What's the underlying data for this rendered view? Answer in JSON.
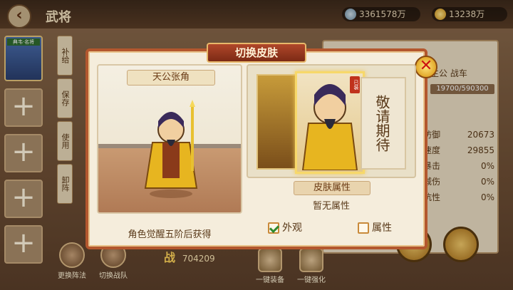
{
  "header": {
    "back_icon": "back-arrow-icon",
    "title": "武将",
    "silver": "3361578万",
    "gold": "13238万"
  },
  "left": {
    "hero_tag": "典韦·名将",
    "slots": [
      "+",
      "+",
      "+",
      "+",
      "+"
    ]
  },
  "vtabs": [
    "补给",
    "保存",
    "使用",
    "卸阵"
  ],
  "right_panel": {
    "name": "主公 战车",
    "exp": "19700/590300",
    "stats": [
      {
        "label": "防御",
        "value": "20673"
      },
      {
        "label": "速度",
        "value": "29855"
      },
      {
        "label": "暴击",
        "value": "0%"
      },
      {
        "label": "减伤",
        "value": "0%"
      },
      {
        "label": "抗性",
        "value": "0%"
      }
    ]
  },
  "bottom": {
    "buttons": [
      "更换阵法",
      "切换战队"
    ],
    "power_label": "战",
    "power_value": "704209",
    "right_buttons": [
      "一键装备",
      "一键强化"
    ]
  },
  "dialog": {
    "title": "切换皮肤",
    "preview_name": "天公张角",
    "acquire_text": "角色觉醒五阶后获得",
    "skin_selected_tag": "已装",
    "coming_soon": "敬请期待",
    "attr_title": "皮肤属性",
    "attr_text": "暂无属性",
    "check_appearance": "外观",
    "check_attr": "属性",
    "appearance_checked": true,
    "attr_checked": false
  }
}
